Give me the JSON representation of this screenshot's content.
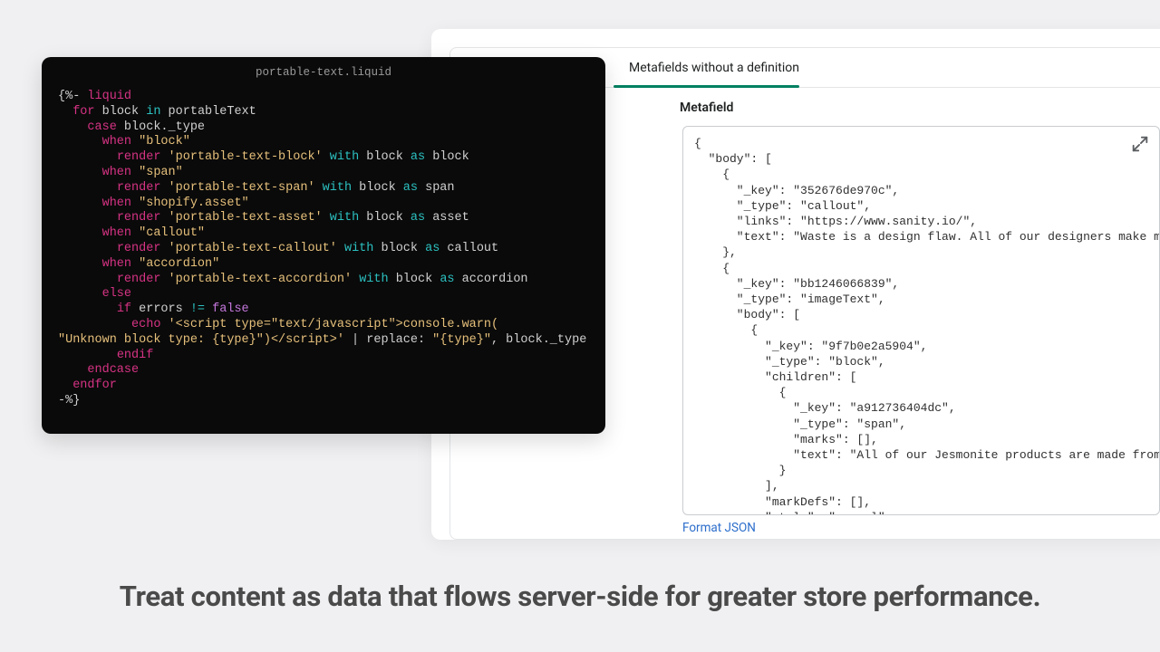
{
  "code_editor": {
    "filename": "portable-text.liquid",
    "lines": [
      [
        [
          "delim",
          "{%- "
        ],
        [
          "kw",
          "liquid"
        ]
      ],
      [
        [
          "plain",
          "  "
        ],
        [
          "kw",
          "for"
        ],
        [
          "plain",
          " block "
        ],
        [
          "op",
          "in"
        ],
        [
          "plain",
          " portableText"
        ]
      ],
      [
        [
          "plain",
          "    "
        ],
        [
          "kw",
          "case"
        ],
        [
          "plain",
          " block._type"
        ]
      ],
      [
        [
          "plain",
          "      "
        ],
        [
          "kw",
          "when"
        ],
        [
          "plain",
          " "
        ],
        [
          "str",
          "\"block\""
        ]
      ],
      [
        [
          "plain",
          "        "
        ],
        [
          "kw",
          "render"
        ],
        [
          "plain",
          " "
        ],
        [
          "str",
          "'portable-text-block'"
        ],
        [
          "plain",
          " "
        ],
        [
          "op",
          "with"
        ],
        [
          "plain",
          " block "
        ],
        [
          "op",
          "as"
        ],
        [
          "plain",
          " block"
        ]
      ],
      [
        [
          "plain",
          "      "
        ],
        [
          "kw",
          "when"
        ],
        [
          "plain",
          " "
        ],
        [
          "str",
          "\"span\""
        ]
      ],
      [
        [
          "plain",
          "        "
        ],
        [
          "kw",
          "render"
        ],
        [
          "plain",
          " "
        ],
        [
          "str",
          "'portable-text-span'"
        ],
        [
          "plain",
          " "
        ],
        [
          "op",
          "with"
        ],
        [
          "plain",
          " block "
        ],
        [
          "op",
          "as"
        ],
        [
          "plain",
          " span"
        ]
      ],
      [
        [
          "plain",
          "      "
        ],
        [
          "kw",
          "when"
        ],
        [
          "plain",
          " "
        ],
        [
          "str",
          "\"shopify.asset\""
        ]
      ],
      [
        [
          "plain",
          "        "
        ],
        [
          "kw",
          "render"
        ],
        [
          "plain",
          " "
        ],
        [
          "str",
          "'portable-text-asset'"
        ],
        [
          "plain",
          " "
        ],
        [
          "op",
          "with"
        ],
        [
          "plain",
          " block "
        ],
        [
          "op",
          "as"
        ],
        [
          "plain",
          " asset"
        ]
      ],
      [
        [
          "plain",
          "      "
        ],
        [
          "kw",
          "when"
        ],
        [
          "plain",
          " "
        ],
        [
          "str",
          "\"callout\""
        ]
      ],
      [
        [
          "plain",
          "        "
        ],
        [
          "kw",
          "render"
        ],
        [
          "plain",
          " "
        ],
        [
          "str",
          "'portable-text-callout'"
        ],
        [
          "plain",
          " "
        ],
        [
          "op",
          "with"
        ],
        [
          "plain",
          " block "
        ],
        [
          "op",
          "as"
        ],
        [
          "plain",
          " callout"
        ]
      ],
      [
        [
          "plain",
          "      "
        ],
        [
          "kw",
          "when"
        ],
        [
          "plain",
          " "
        ],
        [
          "str",
          "\"accordion\""
        ]
      ],
      [
        [
          "plain",
          "        "
        ],
        [
          "kw",
          "render"
        ],
        [
          "plain",
          " "
        ],
        [
          "str",
          "'portable-text-accordion'"
        ],
        [
          "plain",
          " "
        ],
        [
          "op",
          "with"
        ],
        [
          "plain",
          " block "
        ],
        [
          "op",
          "as"
        ],
        [
          "plain",
          " accordion"
        ]
      ],
      [
        [
          "plain",
          "      "
        ],
        [
          "kw",
          "else"
        ]
      ],
      [
        [
          "plain",
          "        "
        ],
        [
          "kw",
          "if"
        ],
        [
          "plain",
          " errors "
        ],
        [
          "op",
          "!="
        ],
        [
          "plain",
          " "
        ],
        [
          "const",
          "false"
        ]
      ],
      [
        [
          "plain",
          "          "
        ],
        [
          "kw",
          "echo"
        ],
        [
          "plain",
          " "
        ],
        [
          "str",
          "'<script type=\"text/javascript\">console.warn("
        ]
      ],
      [
        [
          "str",
          "\"Unknown block type: {type}\")</script>'"
        ],
        [
          "plain",
          " | replace: "
        ],
        [
          "str",
          "\"{type}\""
        ],
        [
          "plain",
          ", block._type"
        ]
      ],
      [
        [
          "plain",
          "        "
        ],
        [
          "kw",
          "endif"
        ]
      ],
      [
        [
          "plain",
          "    "
        ],
        [
          "kw",
          "endcase"
        ]
      ],
      [
        [
          "plain",
          "  "
        ],
        [
          "kw",
          "endfor"
        ]
      ],
      [
        [
          "delim",
          "-%}"
        ]
      ]
    ]
  },
  "metafield_panel": {
    "tab_label": "Metafields without a definition",
    "heading": "Metafield",
    "json_text": "{\n  \"body\": [\n    {\n      \"_key\": \"352676de970c\",\n      \"_type\": \"callout\",\n      \"links\": \"https://www.sanity.io/\",\n      \"text\": \"Waste is a design flaw. All of our designers make mo\n    },\n    {\n      \"_key\": \"bb1246066839\",\n      \"_type\": \"imageText\",\n      \"body\": [\n        {\n          \"_key\": \"9f7b0e2a5904\",\n          \"_type\": \"block\",\n          \"children\": [\n            {\n              \"_key\": \"a912736404dc\",\n              \"_type\": \"span\",\n              \"marks\": [],\n              \"text\": \"All of our Jesmonite products are made from\n            }\n          ],\n          \"markDefs\": [],\n          \"style\": \"normal\"",
    "format_link": "Format JSON"
  },
  "tagline": "Treat content as data that flows server-side for greater store performance."
}
